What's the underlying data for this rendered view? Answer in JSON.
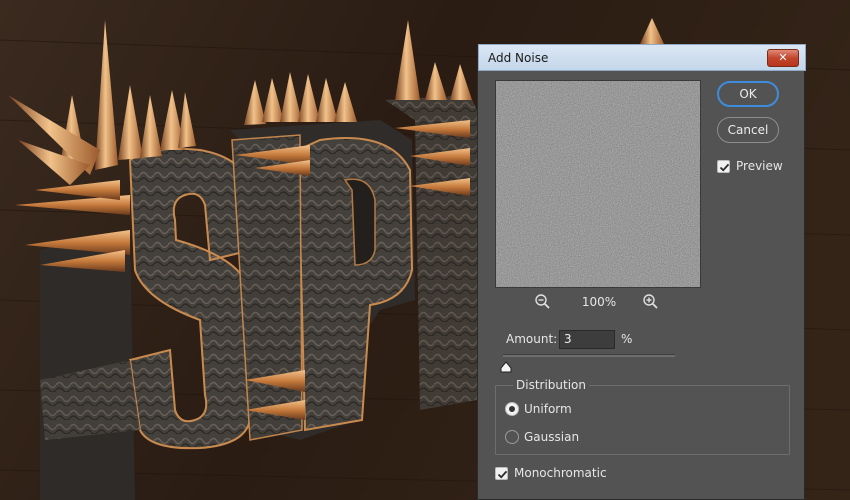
{
  "window": {
    "title": "Add Noise",
    "close_label": "✕"
  },
  "buttons": {
    "ok": "OK",
    "cancel": "Cancel"
  },
  "preview": {
    "label": "Preview",
    "checked": true,
    "zoom_level": "100%"
  },
  "amount": {
    "label": "Amount:",
    "value": "3",
    "unit": "%",
    "slider_fraction": 0.02
  },
  "distribution": {
    "title": "Distribution",
    "options": [
      {
        "label": "Uniform",
        "selected": true
      },
      {
        "label": "Gaussian",
        "selected": false
      }
    ]
  },
  "monochromatic": {
    "label": "Monochromatic",
    "checked": true
  },
  "icons": [
    "zoom-out-icon",
    "zoom-in-icon",
    "checkmark-icon",
    "close-icon",
    "slider-thumb-icon"
  ],
  "colors": {
    "dialog_bg": "#535353",
    "titlebar": "#c4d6ea",
    "close_button": "#c2452c",
    "ok_border": "#3e8cdb",
    "artwork_background": "#2b1d14",
    "letter_stone": "#3a3733",
    "spike_copper": "#c98a4f"
  }
}
